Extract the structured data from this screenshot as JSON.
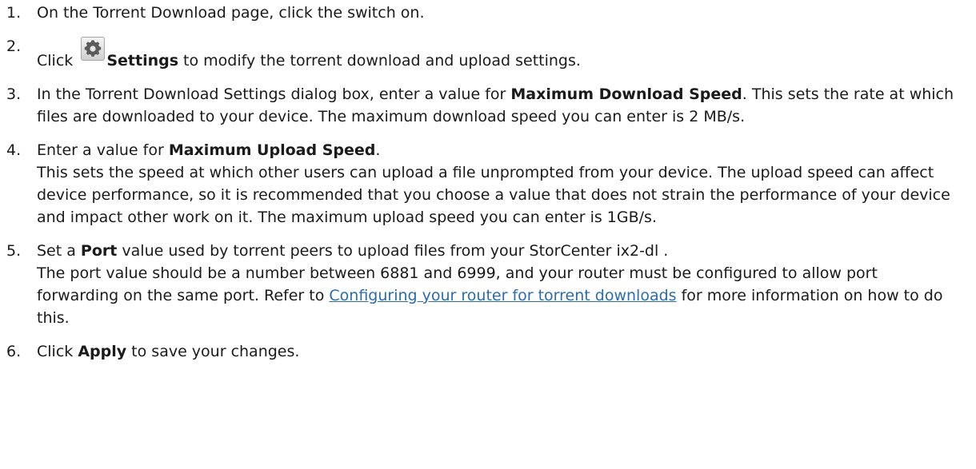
{
  "steps": [
    {
      "num": "1.",
      "parts": [
        {
          "t": "On the Torrent Download page, click the switch on."
        }
      ]
    },
    {
      "num": "2.",
      "parts": [
        {
          "t": "Click "
        },
        {
          "icon": "gear-icon"
        },
        {
          "b": "Settings"
        },
        {
          "t": " to modify the torrent download and upload settings."
        }
      ]
    },
    {
      "num": "3.",
      "parts": [
        {
          "t": "In the Torrent Download Settings dialog box, enter a value for "
        },
        {
          "b": "Maximum Download Speed"
        },
        {
          "t": ". This sets the rate at which files are downloaded to your device. The maximum download speed you can enter is 2 MB/s."
        }
      ]
    },
    {
      "num": "4.",
      "parts": [
        {
          "t": "Enter a value for "
        },
        {
          "b": "Maximum Upload Speed"
        },
        {
          "t": "."
        },
        {
          "br": true
        },
        {
          "t": "This sets the speed at which other users can upload a file unprompted from your device. The upload speed can affect device performance, so it is recommended that you choose a value that does not strain the performance of your device and impact other work on it. The maximum upload speed you can enter is 1GB/s."
        }
      ]
    },
    {
      "num": "5.",
      "parts": [
        {
          "t": "Set a "
        },
        {
          "b": "Port"
        },
        {
          "t": " value used by torrent peers to upload files from your StorCenter ix2-dl ."
        },
        {
          "br": true
        },
        {
          "t": "The port value should be a number between 6881 and 6999, and your router must be configured to allow port forwarding on the same port. Refer to "
        },
        {
          "link": "Configuring your router for torrent downloads"
        },
        {
          "t": " for more information on how to do this."
        }
      ]
    },
    {
      "num": "6.",
      "parts": [
        {
          "t": "Click "
        },
        {
          "b": "Apply"
        },
        {
          "t": " to save your changes."
        }
      ]
    }
  ]
}
